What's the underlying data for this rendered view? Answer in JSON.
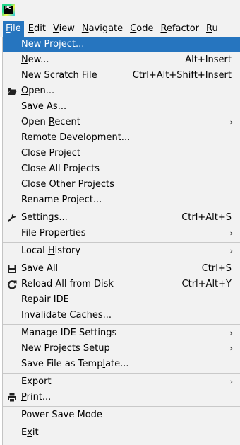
{
  "menubar": {
    "items": [
      {
        "pre": "",
        "mn": "F",
        "post": "ile"
      },
      {
        "pre": "",
        "mn": "E",
        "post": "dit"
      },
      {
        "pre": "",
        "mn": "V",
        "post": "iew"
      },
      {
        "pre": "",
        "mn": "N",
        "post": "avigate"
      },
      {
        "pre": "",
        "mn": "C",
        "post": "ode"
      },
      {
        "pre": "",
        "mn": "R",
        "post": "efactor"
      },
      {
        "pre": "",
        "mn": "R",
        "post": "u"
      }
    ]
  },
  "file_menu": {
    "new_project": "New Project...",
    "new": {
      "pre": "",
      "mn": "N",
      "post": "ew...",
      "shortcut": "Alt+Insert"
    },
    "new_scratch": {
      "label": "New Scratch File",
      "shortcut": "Ctrl+Alt+Shift+Insert"
    },
    "open": {
      "pre": "",
      "mn": "O",
      "post": "pen..."
    },
    "save_as": "Save As...",
    "open_recent": {
      "pre": "Open ",
      "mn": "R",
      "post": "ecent"
    },
    "remote_dev": "Remote Development...",
    "close_project": "Close Project",
    "close_all": "Close All Projects",
    "close_other": "Close Other Projects",
    "rename_project": "Rename Project...",
    "settings": {
      "pre": "Se",
      "mn": "t",
      "post": "tings...",
      "shortcut": "Ctrl+Alt+S"
    },
    "file_properties": "File Properties",
    "local_history": {
      "pre": "Local ",
      "mn": "H",
      "post": "istory"
    },
    "save_all": {
      "pre": "",
      "mn": "S",
      "post": "ave All",
      "shortcut": "Ctrl+S"
    },
    "reload": {
      "label": "Reload All from Disk",
      "shortcut": "Ctrl+Alt+Y"
    },
    "repair_ide": "Repair IDE",
    "invalidate": "Invalidate Caches...",
    "manage_ide": "Manage IDE Settings",
    "new_projects_setup": "New Projects Setup",
    "save_template": {
      "pre": "Save File as Temp",
      "mn": "l",
      "post": "ate..."
    },
    "export": "Export",
    "print": {
      "pre": "",
      "mn": "P",
      "post": "rint..."
    },
    "power_save": "Power Save Mode",
    "exit": {
      "pre": "E",
      "mn": "x",
      "post": "it"
    }
  },
  "arrow_glyph": "›",
  "icons": [
    "app-logo-icon",
    "folder-open-icon",
    "wrench-icon",
    "floppy-disk-icon",
    "reload-icon",
    "printer-icon"
  ],
  "colors": {
    "highlight": "#2675bf",
    "menu_bg": "#f2f2f2",
    "separator": "#c9c9c9"
  }
}
